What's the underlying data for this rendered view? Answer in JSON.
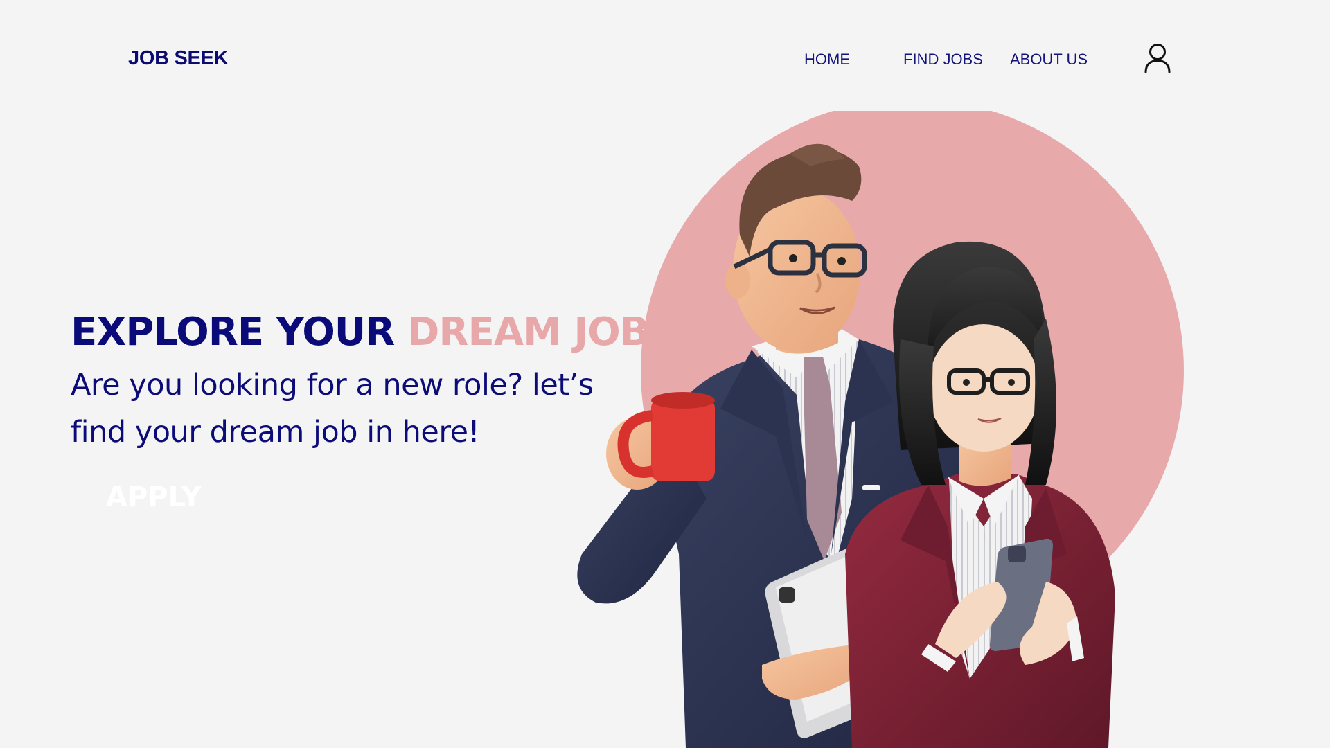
{
  "header": {
    "logo": "JOB SEEK",
    "nav": [
      {
        "label": "HOME"
      },
      {
        "label": "FIND JOBS"
      },
      {
        "label": "ABOUT US"
      }
    ],
    "user_icon": "user-icon"
  },
  "hero": {
    "title_part1": "EXPLORE YOUR",
    "title_part2": "DREAM JOB",
    "subtitle": "Are you looking for a new role? let’s find your dream job in here!",
    "cta_label": "APPLY"
  },
  "colors": {
    "primary_navy": "#0a0a78",
    "accent_pink": "#e8a8aa",
    "background": "#f4f4f4",
    "circle_pink": "#e7a9aa",
    "suit_navy": "#2c3350",
    "blazer_burgundy": "#7e2236",
    "mug_red": "#e23a34"
  },
  "illustration": {
    "description_icons": [
      "businessman-figure",
      "businesswoman-figure",
      "coffee-mug-icon",
      "tablet-icon",
      "smartphone-icon"
    ]
  }
}
